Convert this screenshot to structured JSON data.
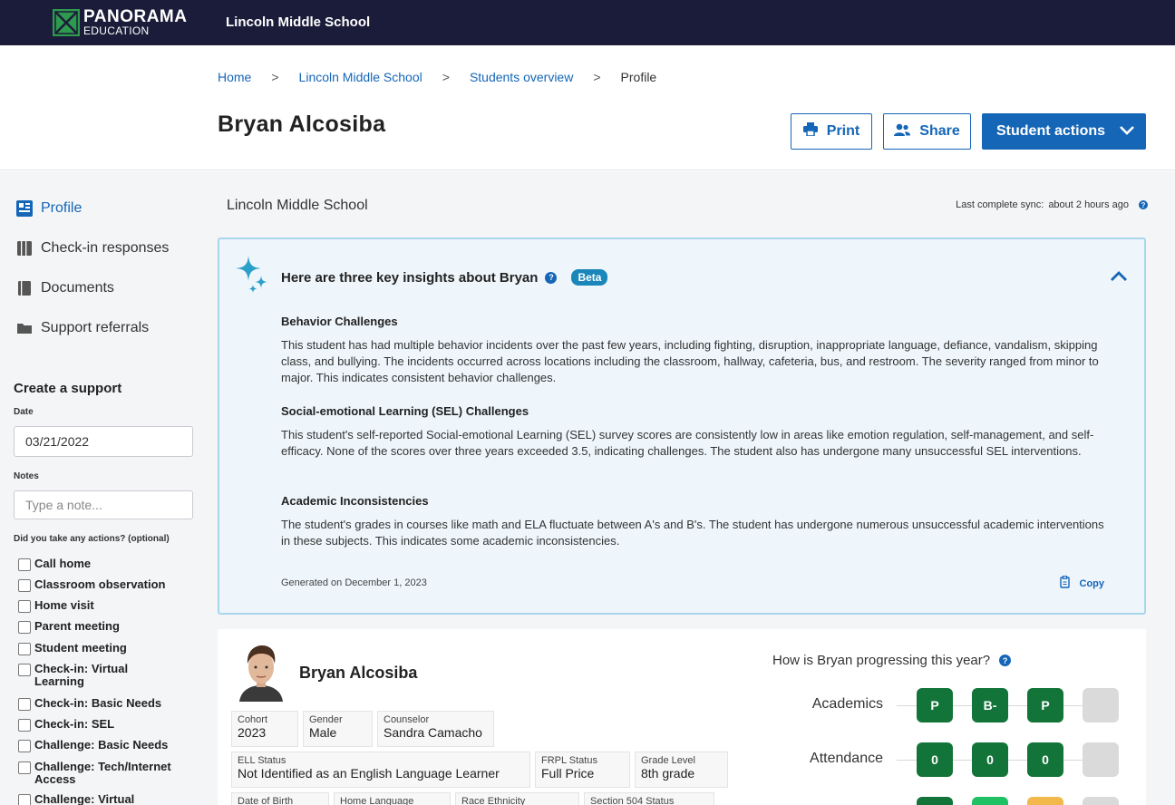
{
  "topbar": {
    "logo_name": "PANORAMA",
    "logo_sub": "EDUCATION",
    "school": "Lincoln Middle School"
  },
  "breadcrumb": {
    "home": "Home",
    "school": "Lincoln Middle School",
    "overview": "Students overview",
    "current": "Profile",
    "separator": ">"
  },
  "header": {
    "title": "Bryan Alcosiba",
    "print": "Print",
    "share": "Share",
    "student_actions": "Student actions"
  },
  "sidebar": {
    "nav": [
      {
        "label": "Profile",
        "icon": "profile-icon"
      },
      {
        "label": "Check-in responses",
        "icon": "book-icon"
      },
      {
        "label": "Documents",
        "icon": "document-icon"
      },
      {
        "label": "Support referrals",
        "icon": "folder-icon"
      }
    ],
    "create_title": "Create a support",
    "date_label": "Date",
    "date_value": "03/21/2022",
    "notes_label": "Notes",
    "notes_placeholder": "Type a note...",
    "actions_label": "Did you take any actions? (optional)",
    "actions": [
      "Call home",
      "Classroom observation",
      "Home visit",
      "Parent meeting",
      "Student meeting",
      "Check-in: Virtual Learning",
      "Check-in: Basic Needs",
      "Check-in: SEL",
      "Challenge: Basic Needs",
      "Challenge: Tech/Internet Access",
      "Challenge: Virtual"
    ]
  },
  "content": {
    "school": "Lincoln Middle School",
    "sync_label": "Last complete sync:",
    "sync_value": "about 2 hours ago"
  },
  "insights": {
    "title": "Here are three key insights about Bryan",
    "badge": "Beta",
    "items": [
      {
        "heading": "Behavior Challenges",
        "text": "This student has had multiple behavior incidents over the past few years, including fighting, disruption, inappropriate language, defiance, vandalism, skipping class, and bullying. The incidents occurred across locations including the classroom, hallway, cafeteria, bus, and restroom. The severity ranged from minor to major. This indicates consistent behavior challenges."
      },
      {
        "heading": "Social-emotional Learning (SEL) Challenges",
        "text": "This student's self-reported Social-emotional Learning (SEL) survey scores are consistently low in areas like emotion regulation, self-management, and self-efficacy. None of the scores over three years exceeded 3.5, indicating challenges. The student also has undergone many unsuccessful SEL interventions."
      },
      {
        "heading": "Academic Inconsistencies",
        "text": "The student's grades in courses like math and ELA fluctuate between A's and B's. The student has undergone numerous unsuccessful academic interventions in these subjects. This indicates some academic inconsistencies."
      }
    ],
    "generated": "Generated on December 1, 2023",
    "copy": "Copy"
  },
  "student": {
    "name": "Bryan Alcosiba",
    "fields": {
      "cohort": {
        "label": "Cohort",
        "value": "2023"
      },
      "gender": {
        "label": "Gender",
        "value": "Male"
      },
      "counselor": {
        "label": "Counselor",
        "value": "Sandra Camacho"
      },
      "ell": {
        "label": "ELL Status",
        "value": "Not Identified as an English Language Learner"
      },
      "frpl": {
        "label": "FRPL Status",
        "value": "Full Price"
      },
      "grade": {
        "label": "Grade Level",
        "value": "8th grade"
      },
      "dob": {
        "label": "Date of Birth",
        "value": ""
      },
      "language": {
        "label": "Home Language",
        "value": ""
      },
      "race": {
        "label": "Race Ethnicity",
        "value": ""
      },
      "section504": {
        "label": "Section 504 Status",
        "value": ""
      }
    }
  },
  "progress": {
    "title": "How is Bryan progressing this year?",
    "rows": [
      {
        "label": "Academics",
        "values": [
          "P",
          "B-",
          "P",
          ""
        ]
      },
      {
        "label": "Attendance",
        "values": [
          "0",
          "0",
          "0",
          ""
        ]
      },
      {
        "label": "",
        "values": [
          "",
          "",
          "",
          ""
        ]
      }
    ],
    "colors": {
      "dark": "#13743a",
      "mid": "#20c165",
      "amber": "#f2b84b",
      "empty": "#dadada"
    }
  },
  "colors": {
    "navy": "#1b1c3a",
    "brand_blue": "#1566b7",
    "insight_bg": "#eef6fb",
    "insight_border": "#a8d6ea",
    "beta": "#1a86b9"
  }
}
